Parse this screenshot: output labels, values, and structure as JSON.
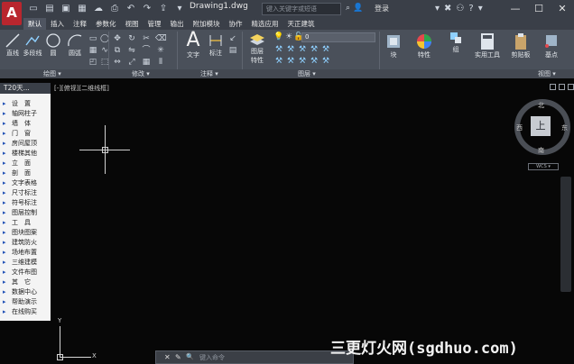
{
  "app": {
    "logo_text": "A",
    "doc_title": "Drawing1.dwg",
    "search_placeholder": "键入关键字或短语",
    "login": "登录"
  },
  "window_controls": {
    "minimize": "—",
    "maximize": "☐",
    "close": "✕"
  },
  "tabs": [
    "默认",
    "插入",
    "注释",
    "参数化",
    "视图",
    "管理",
    "输出",
    "附加模块",
    "协作",
    "精选应用",
    "天正建筑"
  ],
  "ribbon": {
    "draw_tools": {
      "line": "直线",
      "polyline": "多段线",
      "circle": "圆",
      "arc": "圆弧"
    },
    "text_tools": {
      "text": "文字",
      "dimension": "标注"
    },
    "layer_tools": {
      "layer_props": "图层\n特性",
      "layer_value": "0"
    },
    "right_tools": {
      "block": "块",
      "properties": "特性",
      "group": "组",
      "utilities": "实用工具",
      "clipboard": "剪贴板",
      "base": "基点"
    },
    "panel_labels": {
      "draw": "绘图 ▾",
      "modify": "修改 ▾",
      "annotation": "注释 ▾",
      "layers": "图层 ▾",
      "view": "视图 ▾"
    }
  },
  "t20": {
    "header": "T20天...",
    "items": [
      "设　置",
      "轴网柱子",
      "墙　体",
      "门　窗",
      "房间屋顶",
      "楼梯其他",
      "立　面",
      "剖　面",
      "文字表格",
      "尺寸标注",
      "符号标注",
      "图层控制",
      "工　具",
      "图块图案",
      "建筑防火",
      "场地布置",
      "三维建模",
      "文件布图",
      "其　它",
      "数据中心",
      "帮助演示",
      "在线购买"
    ]
  },
  "viewport": {
    "label": "[-][俯视][二维线框]"
  },
  "viewcube": {
    "face": "上",
    "north": "北",
    "south": "南",
    "west": "西",
    "east": "东",
    "wcs": "WCS ▾"
  },
  "ucs": {
    "x": "X",
    "y": "Y"
  },
  "cmdline": {
    "close": "✕",
    "settings": "✎",
    "search": "🔍",
    "placeholder": "键入命令"
  },
  "watermark": "三更灯火网(sgdhuo.com)"
}
